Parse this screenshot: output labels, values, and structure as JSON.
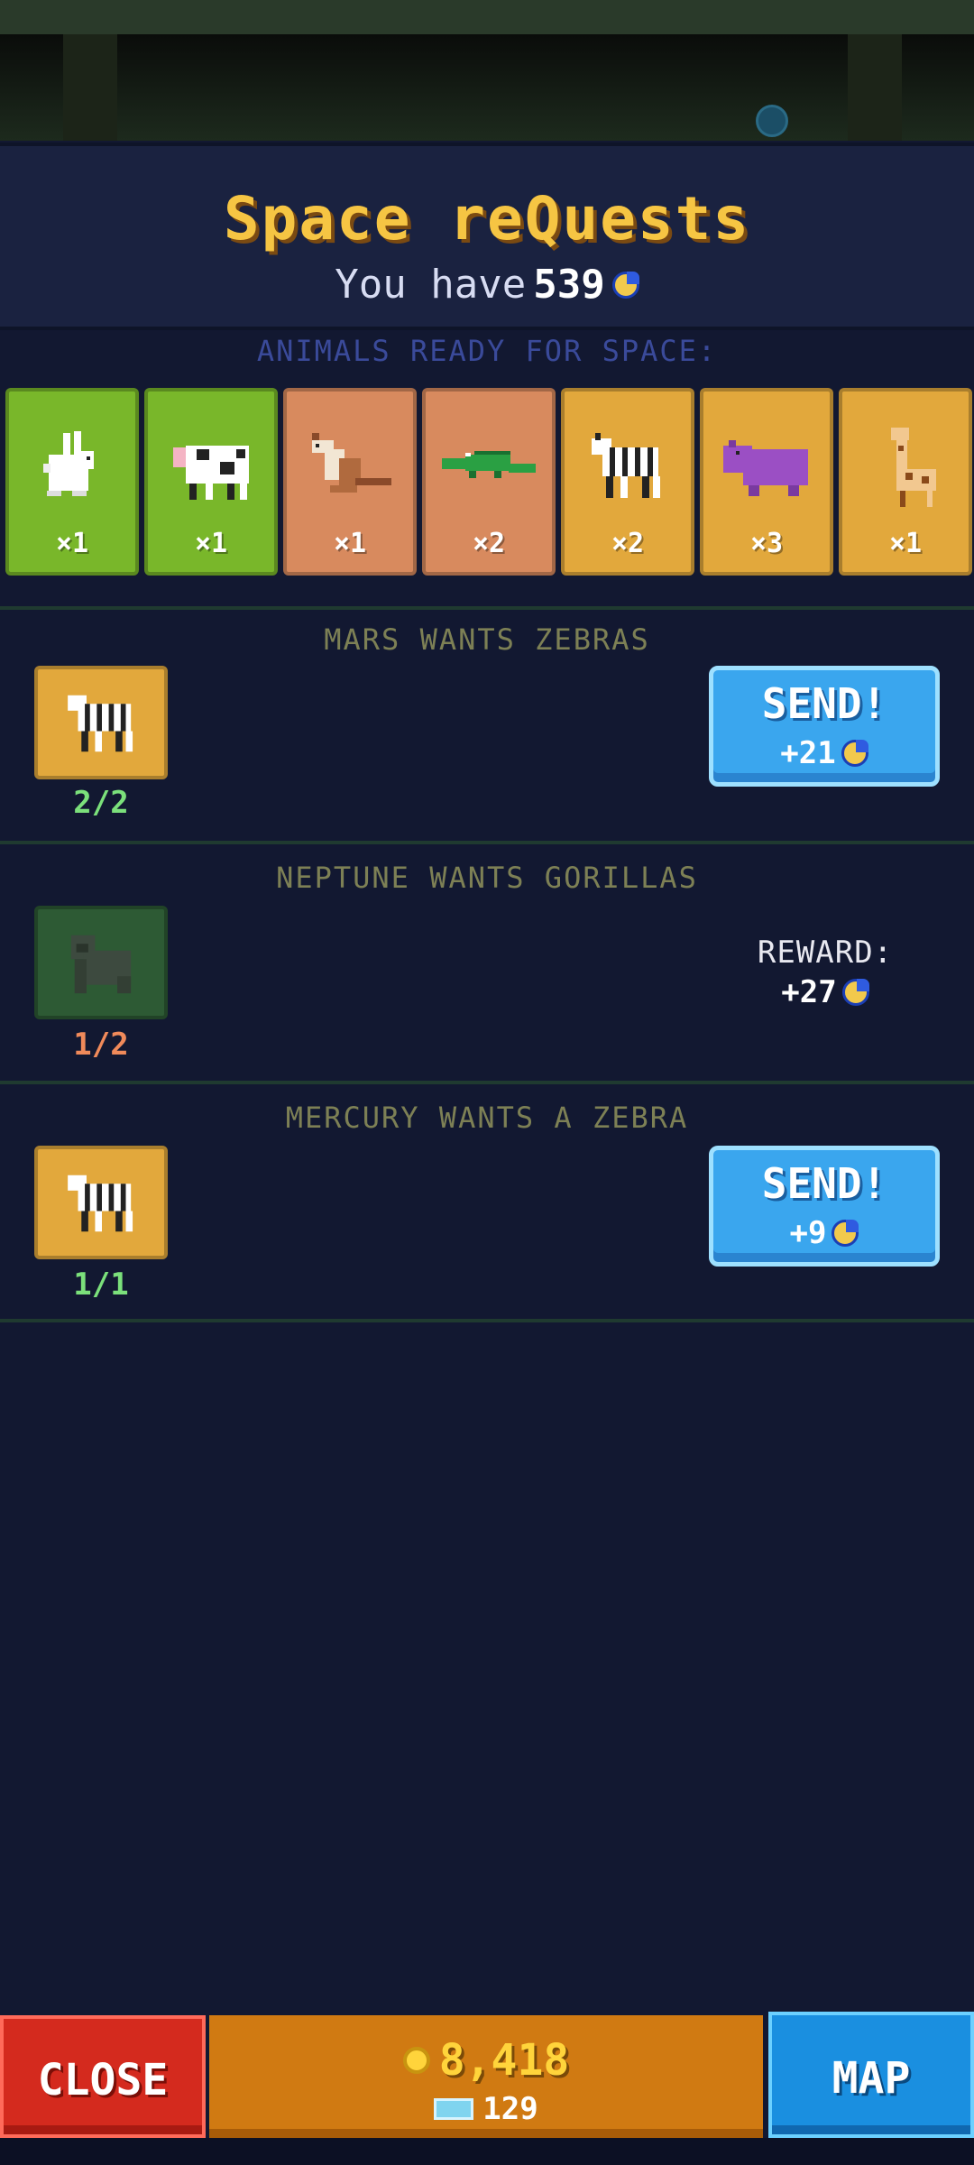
{
  "header": {
    "title": "Space reQuests",
    "balance_prefix": "You have",
    "balance_value": "539",
    "balance_icon": "space-coin-icon"
  },
  "animals_ready": {
    "label": "ANIMALS READY FOR SPACE:",
    "items": [
      {
        "animal": "rabbit",
        "count": "×1",
        "card_color": "#79b72a"
      },
      {
        "animal": "cow",
        "count": "×1",
        "card_color": "#79b72a"
      },
      {
        "animal": "kangaroo",
        "count": "×1",
        "card_color": "#d88a5e"
      },
      {
        "animal": "crocodile",
        "count": "×2",
        "card_color": "#d88a5e"
      },
      {
        "animal": "zebra",
        "count": "×2",
        "card_color": "#e2a83c"
      },
      {
        "animal": "hippo",
        "count": "×3",
        "card_color": "#e2a83c"
      },
      {
        "animal": "giraffe",
        "count": "×1",
        "card_color": "#e2a83c"
      }
    ]
  },
  "quests": [
    {
      "title": "MARS WANTS ZEBRAS",
      "animal": "zebra",
      "progress": "2/2",
      "action": "SEND!",
      "reward": "+21"
    },
    {
      "title": "NEPTUNE WANTS GORILLAS",
      "animal": "gorilla",
      "progress": "1/2",
      "reward_label": "REWARD:",
      "reward": "+27"
    },
    {
      "title": "MERCURY WANTS A ZEBRA",
      "animal": "zebra",
      "progress": "1/1",
      "action": "SEND!",
      "reward": "+9"
    }
  ],
  "bottom_bar": {
    "close_label": "CLOSE",
    "gold": "8,418",
    "gems": "129",
    "map_label": "MAP"
  },
  "colors": {
    "title": "#f6c543",
    "send_button": "#3aa6ee",
    "close_button": "#d42a1e",
    "map_button": "#1a8fe0",
    "currency_panel": "#d07a12"
  }
}
